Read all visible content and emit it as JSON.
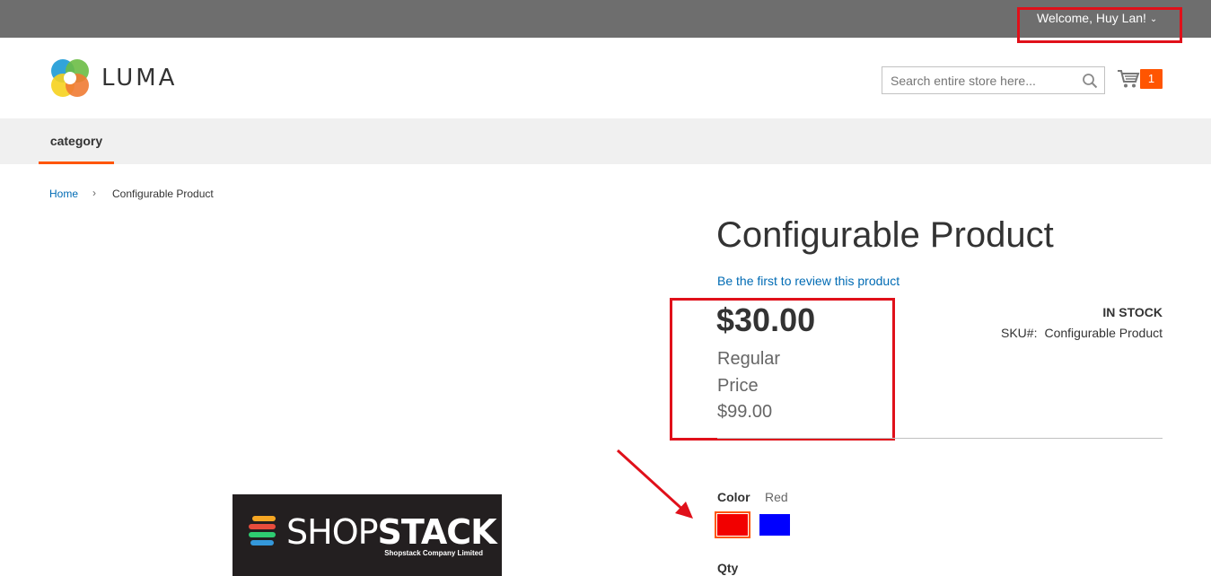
{
  "topbar": {
    "welcome_text": "Welcome, Huy Lan!",
    "chevron_icon": "chevron-down-icon"
  },
  "header": {
    "logo_text": "LUMA",
    "search_placeholder": "Search entire store here...",
    "search_icon": "search-icon",
    "cart_icon": "cart-icon",
    "cart_count": "1"
  },
  "nav": {
    "items": [
      {
        "label": "category"
      }
    ]
  },
  "breadcrumb": {
    "home": "Home",
    "separator": "›",
    "current": "Configurable Product"
  },
  "product": {
    "title": "Configurable Product",
    "review_link": "Be the first to review this product",
    "price": "$30.00",
    "regular_price_label": "Regular Price",
    "regular_price": "$99.00",
    "stock": "IN STOCK",
    "sku_label": "SKU#:",
    "sku_value": "Configurable Product",
    "color_label": "Color",
    "color_selected": "Red",
    "swatches": [
      {
        "name": "Red",
        "color": "#f20000",
        "selected": true
      },
      {
        "name": "Blue",
        "color": "#0000ff",
        "selected": false
      }
    ],
    "qty_label": "Qty"
  },
  "image_logo": {
    "word_light": "SHOP",
    "word_bold": "STACK",
    "subtitle": "Shopstack Company Limited"
  },
  "colors": {
    "accent": "#ff5501",
    "link": "#006bb4",
    "topbar": "#6e6e6e",
    "annotation": "#e0101a"
  }
}
